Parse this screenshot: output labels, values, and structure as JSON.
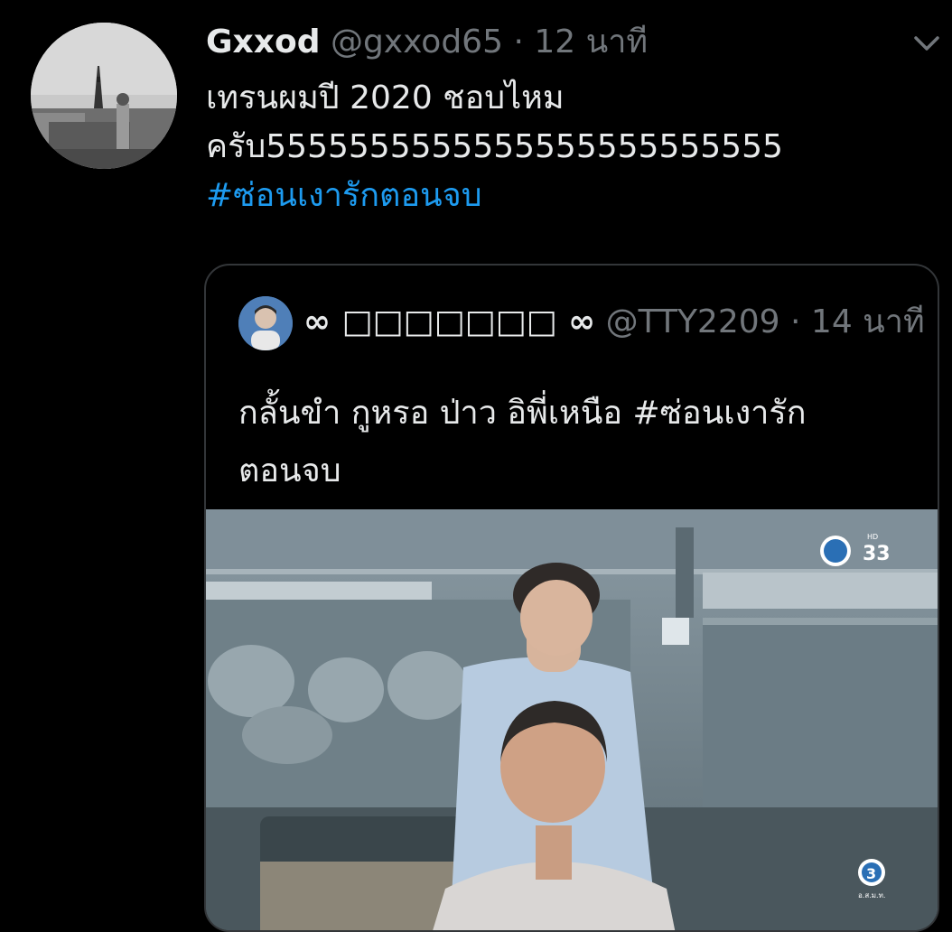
{
  "tweet": {
    "author_name": "Gxxod",
    "author_handle": "@gxxod65",
    "separator": "·",
    "time": "12 นาที",
    "text_lines": [
      "เทรนผมปี 2020 ชอบไหม",
      "ครับ5555555555555555555555555"
    ],
    "hashtag": "#ซ่อนเงารักตอนจบ"
  },
  "quoted_tweet": {
    "author_name": "∞ □□□□□□□ ∞",
    "author_handle": "@TTY2209",
    "separator": "·",
    "time": "14 นาที",
    "text_line1": "กลั้นขำ กูหรอ ป่าว อิพี่เหนือ  ",
    "hashtag_part": "#ซ่อนเงารัก",
    "text_line2": "ตอนจบ"
  },
  "media": {
    "logo_top": "33",
    "logo_top_small": "HD",
    "logo_bottom": "3",
    "logo_bottom_small": "อ.ส.ม.ท."
  },
  "colors": {
    "background": "#000000",
    "text": "#e7e9ea",
    "secondary": "#71767b",
    "link": "#1d9bf0",
    "border": "#333639"
  },
  "icons": [
    "chevron-down-icon"
  ]
}
